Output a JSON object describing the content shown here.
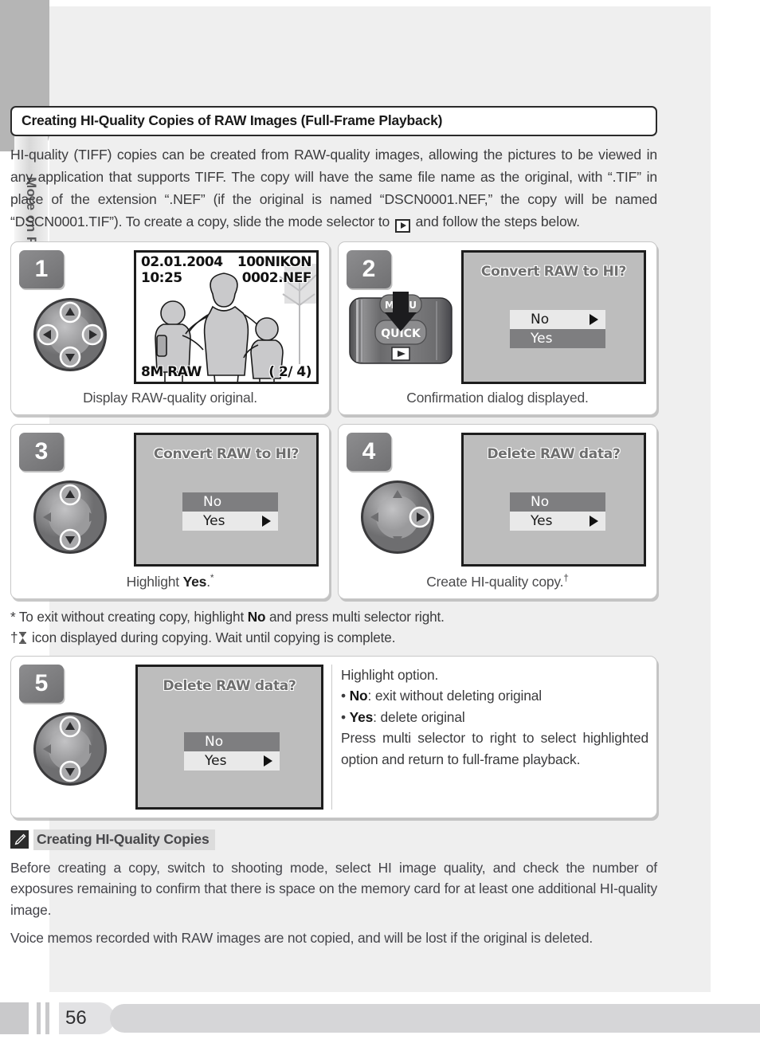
{
  "sidebar": {
    "icon": "playback-icon",
    "label": "More on Playback"
  },
  "section": {
    "title": "Creating HI-Quality Copies of RAW Images (Full-Frame Playback)",
    "intro_part1": "HI-quality (TIFF) copies can be created from RAW-quality images, allowing the pictures to be viewed in any application that supports TIFF.  The copy will have the same file name as the original, with “.TIF” in place of the extension “.NEF” (if the original is named “DSCN0001.NEF,” the copy will be named “DSCN0001.TIF”).  To create a copy, slide the mode selector to ",
    "intro_part2": " and follow the steps below."
  },
  "steps": [
    {
      "number": "1",
      "caption": "Display RAW-quality original.",
      "visual": "lcd-photo",
      "multi_selector": "all",
      "lcd": {
        "date": "02.01.2004",
        "time": "10:25",
        "folder": "100NIKON",
        "file": "0002.NEF",
        "quality": "8M RAW",
        "frame": "(  2/     4)"
      }
    },
    {
      "number": "2",
      "caption": "Confirmation dialog displayed.",
      "visual": "camera-quick-button",
      "camera": {
        "menu_label": "MENU",
        "quick_label": "QUICK",
        "playback_icon": "playback-icon"
      },
      "dialog": {
        "title": "Convert RAW to HI?",
        "options": [
          {
            "label": "No",
            "selected": true
          },
          {
            "label": "Yes",
            "selected": false
          }
        ]
      }
    },
    {
      "number": "3",
      "caption_prefix": "Highlight ",
      "caption_bold": "Yes",
      "caption_suffix": ".",
      "caption_marker": "*",
      "visual": "dialog",
      "multi_selector": "up-down",
      "dialog": {
        "title": "Convert RAW to HI?",
        "options": [
          {
            "label": "No",
            "selected": false
          },
          {
            "label": "Yes",
            "selected": true
          }
        ]
      }
    },
    {
      "number": "4",
      "caption_prefix": "Create HI-quality copy.",
      "caption_marker": "†",
      "visual": "dialog",
      "multi_selector": "right",
      "dialog": {
        "title": "Delete RAW data?",
        "options": [
          {
            "label": "No",
            "selected": false
          },
          {
            "label": "Yes",
            "selected": true
          }
        ]
      }
    }
  ],
  "footnotes": {
    "star_marker": "*",
    "star_pre": " To exit without creating copy, highlight ",
    "star_bold": "No",
    "star_post": " and press multi selector right.",
    "dagger_marker": "†",
    "dagger_pre": " ",
    "dagger_post": " icon displayed during copying.  Wait until copying is complete.",
    "dagger_icon": "hourglass-icon"
  },
  "step5": {
    "number": "5",
    "multi_selector": "up-down",
    "dialog": {
      "title": "Delete RAW data?",
      "options": [
        {
          "label": "No",
          "selected": false
        },
        {
          "label": "Yes",
          "selected": true
        }
      ]
    },
    "desc_line1": "Highlight option.",
    "desc_bullet1_bold": "No",
    "desc_bullet1_rest": ": exit without deleting original",
    "desc_bullet2_bold": "Yes",
    "desc_bullet2_rest": ": delete original",
    "desc_para": "Press multi selector to right to select highlighted option and return to full-frame playback."
  },
  "note": {
    "icon": "pencil-icon",
    "title": "Creating HI-Quality Copies",
    "para1": "Before creating a copy, switch to shooting mode, select HI image quality, and check the number of exposures remaining to confirm that there is space on the memory card for at least one additional HI-quality image.",
    "para2": "Voice memos recorded with RAW images are not copied, and will be lost if the original is deleted."
  },
  "footer": {
    "page_number": "56"
  },
  "colors": {
    "page_bg": "#ffffff",
    "content_bg": "#efefef",
    "tab_gray": "#b5b5b5",
    "dialog_bg": "#bdbdbd",
    "selected_row": "#e9e9e9",
    "unselected_row": "#7e7e80",
    "badge_gray": "#7f7f81",
    "text": "#3b3b3d"
  }
}
